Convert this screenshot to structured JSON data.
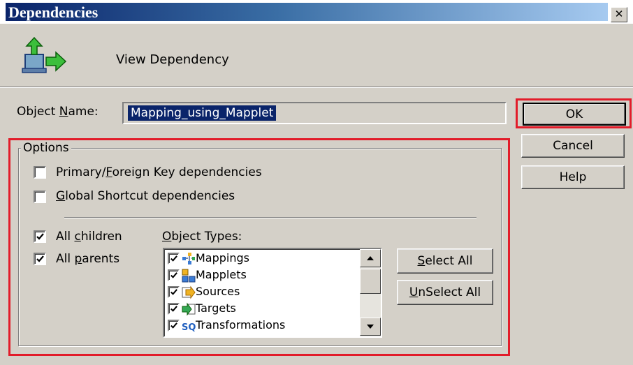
{
  "window": {
    "title": "Dependencies",
    "close_glyph": "✕"
  },
  "header": {
    "text": "View Dependency",
    "icon": "view-dependency-icon"
  },
  "object_name": {
    "label_pre": "Object ",
    "label_u": "N",
    "label_post": "ame:",
    "value": "Mapping_using_Mapplet"
  },
  "buttons": {
    "ok": "OK",
    "cancel": "Cancel",
    "help": "Help",
    "select_all_u": "S",
    "select_all_rest": "elect All",
    "unselect_all_u": "U",
    "unselect_all_rest": "nSelect All"
  },
  "options": {
    "group_label": "Options",
    "primary_foreign": {
      "pre": "Primary/",
      "u": "F",
      "post": "oreign Key dependencies",
      "checked": false
    },
    "global_shortcut": {
      "u": "G",
      "post": "lobal Shortcut dependencies",
      "checked": false
    },
    "all_children": {
      "pre": "All ",
      "u": "c",
      "post": "hildren",
      "checked": true
    },
    "all_parents": {
      "pre": "All ",
      "u": "p",
      "post": "arents",
      "checked": true
    }
  },
  "object_types": {
    "label_u": "O",
    "label_rest": "bject Types:",
    "items": [
      {
        "label": "Mappings",
        "icon": "mappings-icon",
        "checked": true
      },
      {
        "label": "Mapplets",
        "icon": "mapplets-icon",
        "checked": true
      },
      {
        "label": "Sources",
        "icon": "sources-icon",
        "checked": true
      },
      {
        "label": "Targets",
        "icon": "targets-icon",
        "checked": true
      },
      {
        "label": "Transformations",
        "icon": "transformations-icon",
        "checked": true
      }
    ]
  },
  "colors": {
    "highlight": "#e21c2a",
    "selection": "#0a246a",
    "face": "#d4d0c8"
  }
}
